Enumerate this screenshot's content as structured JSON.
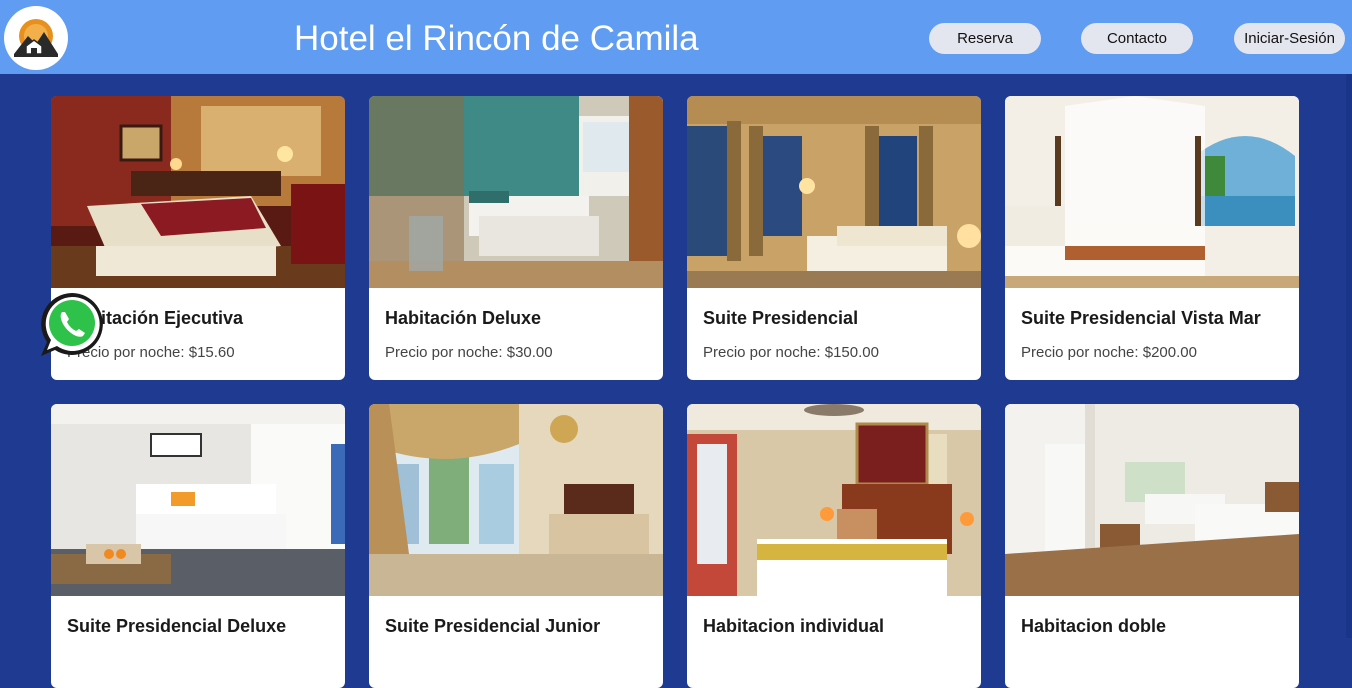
{
  "header": {
    "title": "Hotel el Rincón de Camila",
    "nav": [
      "Reserva",
      "Contacto",
      "Iniciar-Sesión"
    ],
    "logo_icon": "mountain-house-logo"
  },
  "rooms": [
    {
      "name": "Habitación Ejecutiva",
      "price": "Precio por noche: $15.60"
    },
    {
      "name": "Habitación Deluxe",
      "price": "Precio por noche: $30.00"
    },
    {
      "name": "Suite Presidencial",
      "price": "Precio por noche: $150.00"
    },
    {
      "name": "Suite Presidencial Vista Mar",
      "price": "Precio por noche: $200.00"
    },
    {
      "name": "Suite Presidencial Deluxe",
      "price": ""
    },
    {
      "name": "Suite Presidencial Junior",
      "price": ""
    },
    {
      "name": "Habitacion individual",
      "price": ""
    },
    {
      "name": "Habitacion doble",
      "price": ""
    }
  ],
  "floating": {
    "icon": "whatsapp-icon"
  },
  "colors": {
    "header": "#5f9cf2",
    "page": "#1f3b91",
    "card": "#ffffff",
    "button": "#e4e6ef"
  }
}
